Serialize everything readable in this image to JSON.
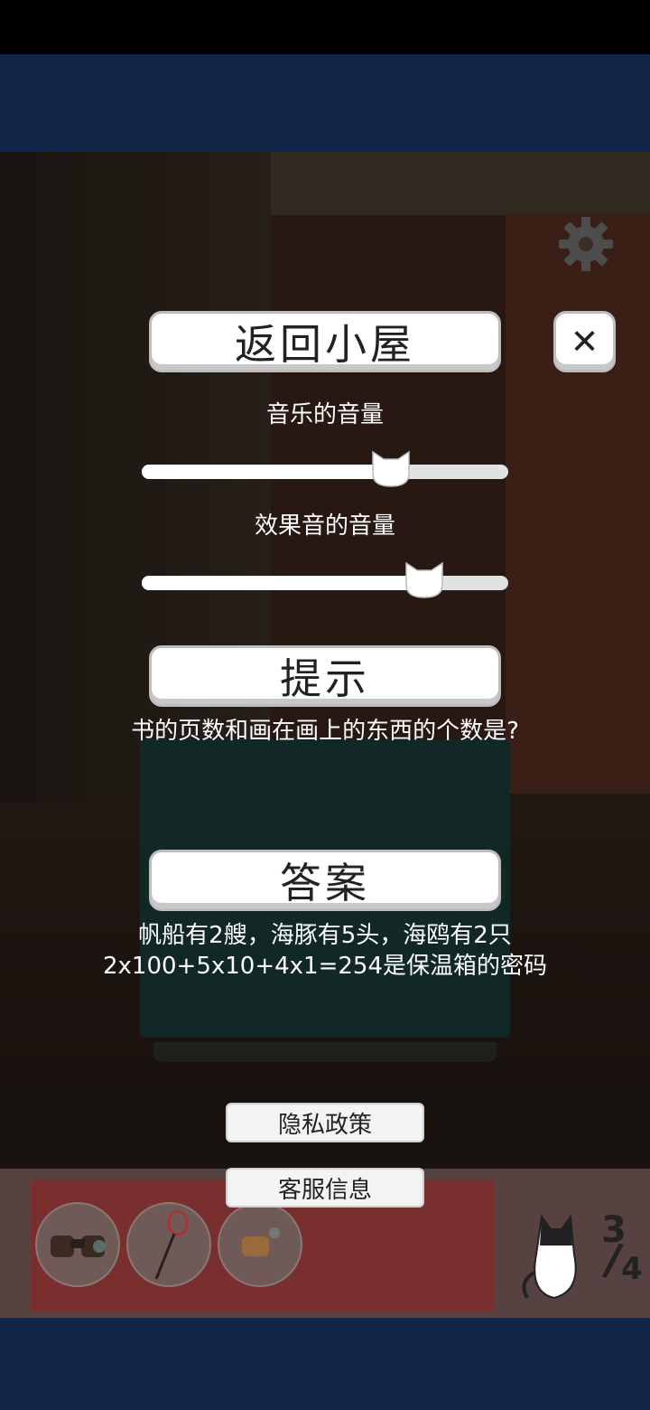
{
  "menu": {
    "return_label": "返回小屋",
    "close_label": "✕",
    "music_volume_label": "音乐的音量",
    "music_volume": 0.68,
    "sfx_volume_label": "效果音的音量",
    "sfx_volume": 0.77,
    "hint_label": "提示",
    "hint_text": "书的页数和画在画上的东西的个数是?",
    "answer_label": "答案",
    "answer_line1": "帆船有2艘，海豚有5头，海鸥有2只",
    "answer_line2": "2x100+5x10+4x1=254是保温箱的密码",
    "privacy_label": "隐私政策",
    "support_label": "客服信息"
  },
  "inventory": {
    "items": [
      {
        "name": "binoculars",
        "icon": "binoculars-icon"
      },
      {
        "name": "fishing-rod",
        "icon": "fishing-rod-icon"
      },
      {
        "name": "corkscrew",
        "icon": "corkscrew-icon"
      }
    ],
    "page_current": "3",
    "page_total": "4"
  },
  "icons": {
    "settings": "gear-icon",
    "close": "close-icon",
    "slider_knob": "cat-head-icon",
    "mascot": "cat-icon"
  },
  "colors": {
    "band": "#112548",
    "inventory_strip": "#7a2f2f",
    "button_face": "#ffffff"
  }
}
